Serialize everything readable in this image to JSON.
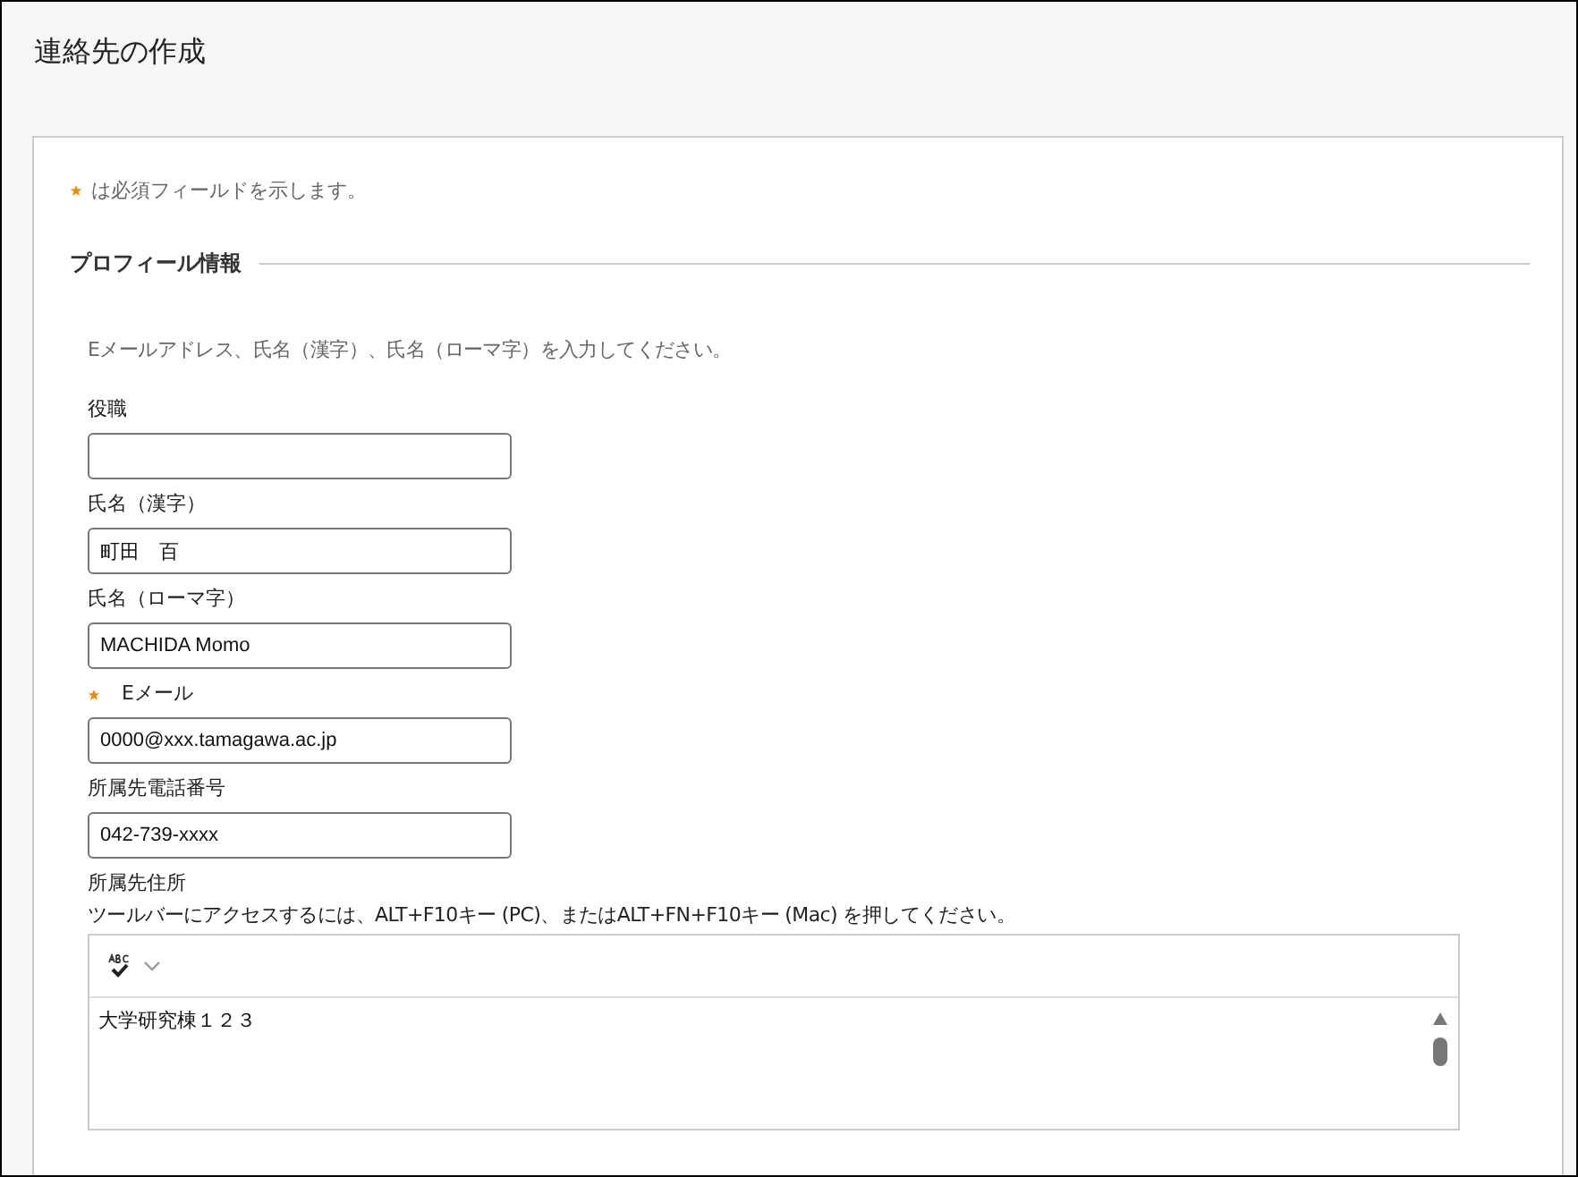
{
  "window": {
    "title": "連絡先の作成"
  },
  "required_note": "は必須フィールドを示します。",
  "section": {
    "title": "プロフィール情報",
    "instruction": "Eメールアドレス、氏名（漢字）、氏名（ローマ字）を入力してください。",
    "fields": [
      {
        "label": "役職",
        "required": false
      },
      {
        "label": "氏名（漢字）",
        "required": false,
        "value": "町田　百"
      },
      {
        "label": "氏名（ローマ字）",
        "required": false,
        "value": "MACHIDA Momo"
      },
      {
        "label": "Eメール",
        "required": true,
        "value": "0000@xxx.tamagawa.ac.jp"
      },
      {
        "label": "所属先電話番号",
        "required": false,
        "value": "042-739-xxxx"
      }
    ],
    "address": {
      "label": "所属先住所",
      "hint": "ツールバーにアクセスするには、ALT+F10キー (PC)、またはALT+FN+F10キー (Mac) を押してください。",
      "value": "大学研究棟１２３"
    }
  }
}
